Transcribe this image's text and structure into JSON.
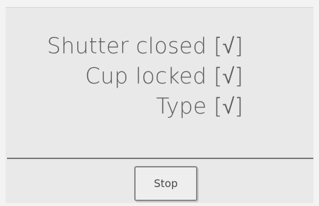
{
  "status": {
    "items": [
      {
        "label": "Shutter closed [√]"
      },
      {
        "label": "Cup locked [√]"
      },
      {
        "label": "Type [√]"
      }
    ]
  },
  "footer": {
    "stop_label": "Stop"
  },
  "colors": {
    "background": "#e9e9e9",
    "text": "#5a5a5a",
    "divider": "#7a7a7a"
  }
}
